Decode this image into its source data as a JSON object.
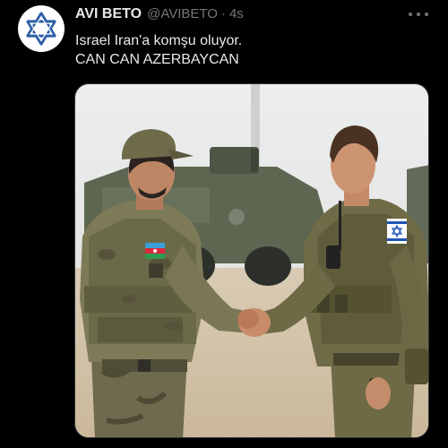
{
  "post": {
    "author": {
      "display_name": "AVI BETO",
      "handle": "@AVIBETO",
      "separator": "·",
      "timestamp": "4s",
      "avatar_icon": "star-of-david-icon"
    },
    "more_icon": "more-options-icon",
    "text_lines": [
      "Israel Iran'a komşu oluyor.",
      "CAN CAN AZERBAYCAN"
    ],
    "media": {
      "type": "photo",
      "patches": {
        "left": "azerbaijan-flag-patch",
        "right": "israel-flag-patch"
      }
    }
  },
  "colors": {
    "background": "#000000",
    "text_primary": "#e7e9ea",
    "text_secondary": "#71767b",
    "avatar_blue": "#2d5fa8"
  }
}
